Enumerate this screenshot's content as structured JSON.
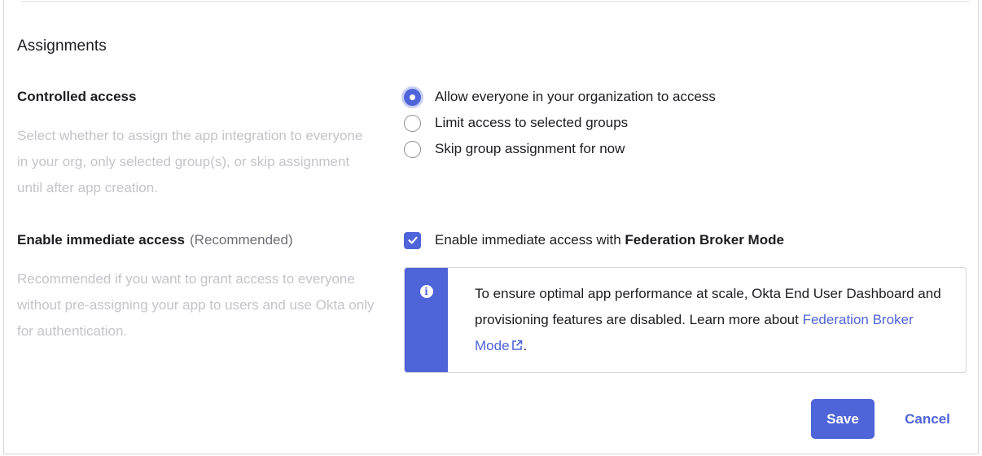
{
  "section": {
    "title": "Assignments"
  },
  "controlled_access": {
    "label": "Controlled access",
    "description": "Select whether to assign the app integration to everyone in your org, only selected group(s), or skip assignment until after app creation.",
    "options": [
      {
        "label": "Allow everyone in your organization to access",
        "checked": true
      },
      {
        "label": "Limit access to selected groups",
        "checked": false
      },
      {
        "label": "Skip group assignment for now",
        "checked": false
      }
    ]
  },
  "immediate_access": {
    "label": "Enable immediate access",
    "recommended": "(Recommended)",
    "description": "Recommended if you want to grant access to everyone without pre-assigning your app to users and use Okta only for authentication.",
    "checkbox_prefix": "Enable immediate access with ",
    "checkbox_bold": "Federation Broker Mode",
    "checked": true,
    "callout": {
      "text_before": "To ensure optimal app performance at scale, Okta End User Dashboard and provisioning features are disabled. Learn more about ",
      "link_text": "Federation Broker Mode",
      "text_after": "."
    }
  },
  "actions": {
    "save_label": "Save",
    "cancel_label": "Cancel"
  },
  "colors": {
    "accent": "#4f64d9",
    "muted_text": "#c4c4ca",
    "border": "#d7d7dc"
  },
  "icons": {
    "info": "info-icon",
    "external_link": "external-link-icon",
    "check": "check-icon"
  }
}
